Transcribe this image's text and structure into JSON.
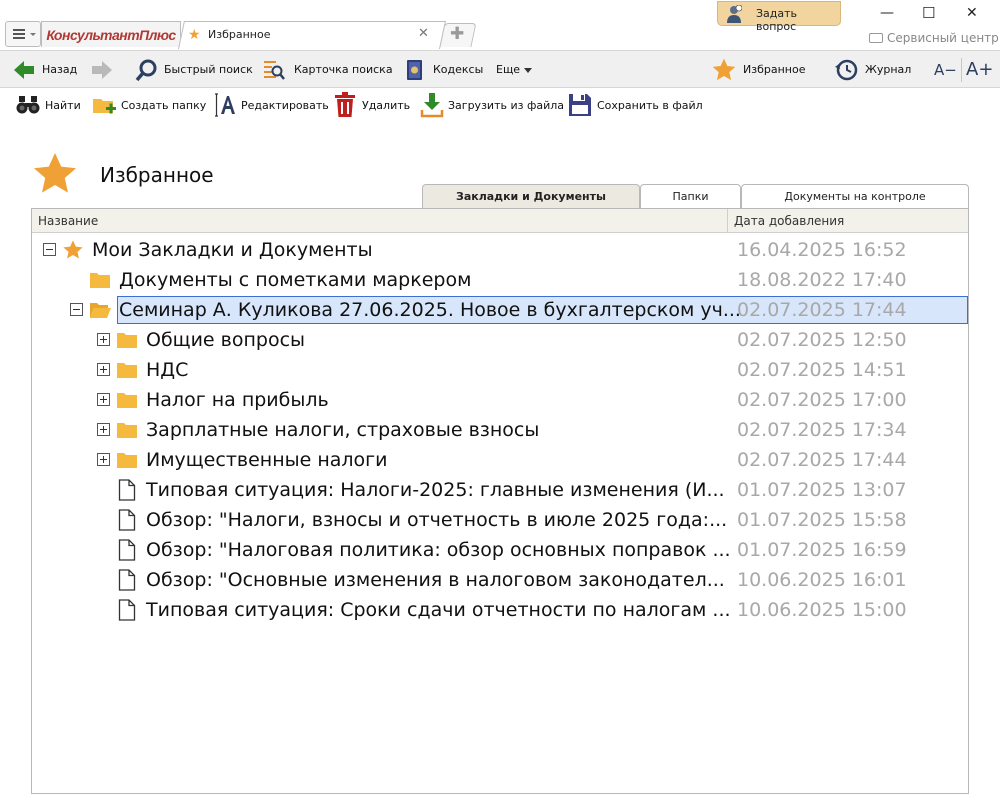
{
  "titlebar": {
    "logo": "КонсультантПлюс",
    "tab_title": "Избранное",
    "ask_button": "Задать вопрос",
    "service_center": "Сервисный центр"
  },
  "navbar": {
    "back": "Назад",
    "quick_search": "Быстрый поиск",
    "search_card": "Карточка поиска",
    "codes": "Кодексы",
    "more": "Еще",
    "favorites": "Избранное",
    "journal": "Журнал",
    "font_smaller": "A−",
    "font_larger": "A+"
  },
  "actions": {
    "find": "Найти",
    "create_folder": "Создать папку",
    "edit": "Редактировать",
    "delete": "Удалить",
    "load_from_file": "Загрузить из файла",
    "save_to_file": "Сохранить в файл"
  },
  "page": {
    "title": "Избранное",
    "tabs": [
      "Закладки и Документы",
      "Папки",
      "Документы на контроле"
    ]
  },
  "grid": {
    "col_name": "Название",
    "col_date": "Дата добавления",
    "rows": [
      {
        "name": "Мои Закладки и Документы",
        "date": "16.04.2025 16:52"
      },
      {
        "name": "Документы с пометками маркером",
        "date": "18.08.2022 17:40"
      },
      {
        "name": "Семинар А. Куликова 27.06.2025. Новое в бухгалтерском уч...",
        "date": "02.07.2025 17:44"
      },
      {
        "name": "Общие вопросы",
        "date": "02.07.2025 12:50"
      },
      {
        "name": "НДС",
        "date": "02.07.2025 14:51"
      },
      {
        "name": "Налог на прибыль",
        "date": "02.07.2025 17:00"
      },
      {
        "name": "Зарплатные налоги, страховые взносы",
        "date": "02.07.2025 17:34"
      },
      {
        "name": "Имущественные налоги",
        "date": "02.07.2025 17:44"
      },
      {
        "name": "Типовая ситуация: Налоги-2025: главные изменения (И...",
        "date": "01.07.2025 13:07"
      },
      {
        "name": "Обзор: \"Налоги, взносы и отчетность в июле 2025 года:...",
        "date": "01.07.2025 15:58"
      },
      {
        "name": "Обзор: \"Налоговая политика: обзор основных поправок ...",
        "date": "01.07.2025 16:59"
      },
      {
        "name": "Обзор: \"Основные изменения в налоговом законодател...",
        "date": "10.06.2025 16:01"
      },
      {
        "name": "Типовая ситуация: Сроки сдачи отчетности по налогам ...",
        "date": "10.06.2025 15:00"
      }
    ]
  },
  "colors": {
    "accent_star": "#f0a135",
    "folder": "#f5b93e",
    "back_arrow": "#2f8a2a",
    "selection": "#d8e6fb",
    "date_text": "#a8a8a8"
  }
}
